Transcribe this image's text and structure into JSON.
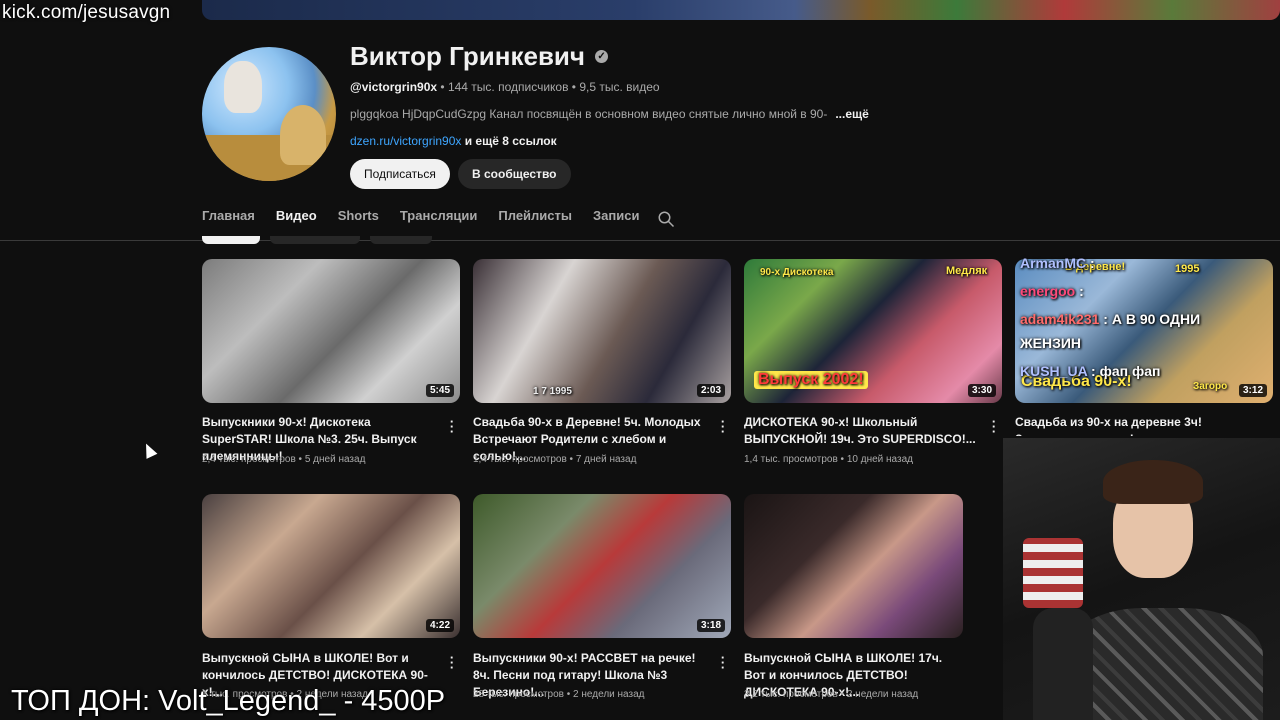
{
  "overlay": {
    "stream_url": "kick.com/jesusavgn",
    "top_donor": "ТОП ДОН: Volt_Legend_ - 4500P"
  },
  "channel": {
    "name": "Виктор Гринкевич",
    "handle": "@victorgrin90x",
    "stats": " • 144 тыс. подписчиков • 9,5 тыс. видео",
    "description": "plggqkoa HjDqpCudGzpg Канал посвящён в основном видео снятые лично мной в 90-",
    "more_label": "...ещё",
    "link": "dzen.ru/victorgrin90x",
    "link_extra": " и ещё 8 ссылок",
    "subscribe_label": "Подписаться",
    "community_label": "В сообщество"
  },
  "tabs": [
    {
      "label": "Главная"
    },
    {
      "label": "Видео"
    },
    {
      "label": "Shorts"
    },
    {
      "label": "Трансляции"
    },
    {
      "label": "Плейлисты"
    },
    {
      "label": "Записи"
    }
  ],
  "videos": [
    {
      "title": "Выпускники 90-х! Дискотека SuperSTAR! Школа №3. 25ч. Выпуск племянницы!",
      "meta": "2,4 тыс. просмотров • 5 дней назад",
      "duration": "5:45"
    },
    {
      "title": "Свадьба 90-х в Деревне! 5ч. Молодых Встречают Родители с хлебом и солью!...",
      "meta": "1,4 тыс. просмотров • 7 дней назад",
      "duration": "2:03"
    },
    {
      "title": "ДИСКОТЕКА 90-х! Школьный ВЫПУСКНОЙ! 19ч. Это SUPERDISCO!...",
      "meta": "1,4 тыс. просмотров • 10 дней назад",
      "duration": "3:30"
    },
    {
      "title": "Свадьба из 90-х на деревне 3ч! Загорелись дороги!",
      "meta": "",
      "duration": "3:12"
    },
    {
      "title": "Выпускной СЫНА в ШКОЛЕ! Вот и кончилось ДЕТСТВО! ДИСКОТЕКА 90-х!...",
      "meta": "1 тыс. просмотров • 2 недели назад",
      "duration": "4:22"
    },
    {
      "title": "Выпускники 90-х! РАССВЕТ на речке! 8ч. Песни под гитару! Школа №3 Березино!...",
      "meta": "28 тыс. просмотров • 2 недели назад",
      "duration": "3:18"
    },
    {
      "title": "Выпускной СЫНА в ШКОЛЕ! 17ч. Вот и кончилось ДЕТСТВО! ДИСКОТЕКА 90-х!...",
      "meta": "3,2 тыс. просмотров • 2 недели назад",
      "duration": ""
    }
  ],
  "thumb_text": {
    "t3_top": "90-х Дискотека",
    "t3_right": "Медляк",
    "t3_bottom": "Выпуск 2002!",
    "t4_top": "В деревне!",
    "t4_year": "1995",
    "t4_bottom": "Свадьба 90-х!",
    "t4_right": "Загоро",
    "t2_date": "1  7  1995"
  },
  "chat": [
    {
      "user": "ArmanMC",
      "text": " :"
    },
    {
      "user": "energoo",
      "text": " :"
    },
    {
      "user": "adam4ik231",
      "text": " : А В 90 ОДНИ"
    },
    {
      "user": "",
      "text": "ЖЕНЗИН"
    },
    {
      "user": "KUSH_UA",
      "text": " : фап фап"
    }
  ]
}
